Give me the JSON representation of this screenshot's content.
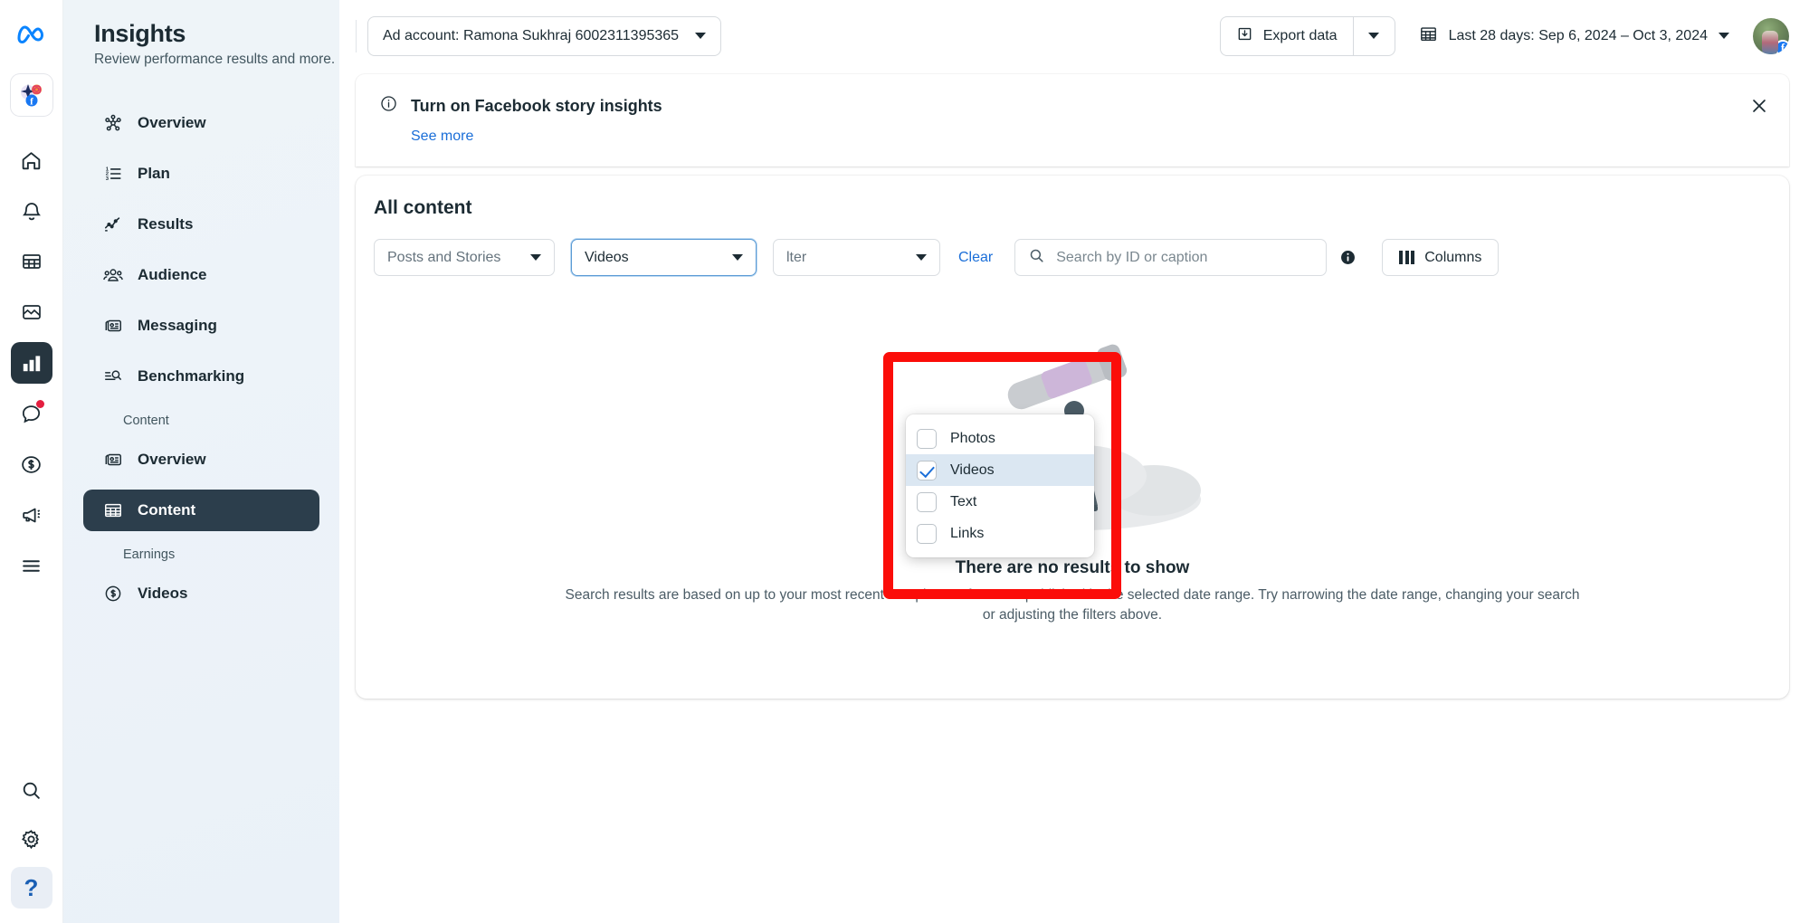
{
  "rail": {
    "icons": [
      {
        "name": "meta-logo-icon",
        "label": "Meta"
      },
      {
        "name": "ai-suite-icon",
        "label": "Meta AI suite"
      },
      {
        "name": "home-icon",
        "label": "Home"
      },
      {
        "name": "notifications-bell-icon",
        "label": "Notifications"
      },
      {
        "name": "table-icon",
        "label": "Table"
      },
      {
        "name": "media-icon",
        "label": "Media"
      },
      {
        "name": "insights-bar-chart-icon",
        "label": "Insights"
      },
      {
        "name": "messages-icon",
        "label": "Messages"
      },
      {
        "name": "monetization-icon",
        "label": "Monetization"
      },
      {
        "name": "ads-megaphone-icon",
        "label": "Ads"
      },
      {
        "name": "more-menu-icon",
        "label": "More"
      },
      {
        "name": "search-icon",
        "label": "Search"
      },
      {
        "name": "settings-gear-icon",
        "label": "Settings"
      },
      {
        "name": "help-icon",
        "label": "Help"
      }
    ],
    "help_glyph": "?"
  },
  "sidebar": {
    "title": "Insights",
    "subtitle": "Review performance results and more.",
    "items": [
      {
        "label": "Overview",
        "icon": "network-overview-icon",
        "active": false
      },
      {
        "label": "Plan",
        "icon": "numbered-list-icon",
        "active": false
      },
      {
        "label": "Results",
        "icon": "line-chart-icon",
        "active": false
      },
      {
        "label": "Audience",
        "icon": "people-icon",
        "active": false
      },
      {
        "label": "Messaging",
        "icon": "cards-icon",
        "active": false
      },
      {
        "label": "Benchmarking",
        "icon": "compare-search-icon",
        "active": false
      }
    ],
    "sections": [
      {
        "heading": "Content",
        "items": [
          {
            "label": "Overview",
            "icon": "cards-icon",
            "active": false
          },
          {
            "label": "Content",
            "icon": "grid-table-icon",
            "active": true
          }
        ]
      },
      {
        "heading": "Earnings",
        "items": [
          {
            "label": "Videos",
            "icon": "dollar-circle-icon",
            "active": false
          }
        ]
      }
    ],
    "collapse_icon": "collapse-panel-icon"
  },
  "topbar": {
    "ad_account": "Ad account: Ramona Sukhraj 6002311395365",
    "export_label": "Export data",
    "export_icon": "download-icon",
    "date_range": "Last 28 days: Sep 6, 2024 – Oct 3, 2024",
    "calendar_icon": "calendar-icon",
    "avatar_badge": "f"
  },
  "banner": {
    "icon": "info-circle-icon",
    "title": "Turn on Facebook story insights",
    "link": "See more",
    "close_icon": "close-icon"
  },
  "content": {
    "title": "All content",
    "filters": {
      "posts_and_stories": "Posts and Stories",
      "media_type": "Videos",
      "third_filter": "lter",
      "clear_label": "Clear",
      "search_placeholder": "Search by ID or caption",
      "search_value": "",
      "search_icon": "search-icon",
      "info_icon": "info-icon",
      "columns_label": "Columns",
      "columns_icon": "columns-icon"
    },
    "dropdown": {
      "options": [
        {
          "label": "Photos",
          "checked": false
        },
        {
          "label": "Videos",
          "checked": true
        },
        {
          "label": "Text",
          "checked": false
        },
        {
          "label": "Links",
          "checked": false
        }
      ]
    },
    "empty_state": {
      "illustration": "telescope-illustration",
      "title": "There are no results to show",
      "description": "Search results are based on up to your most recent 200 pieces of content published in the selected date range. Try narrowing the date range, changing your search or adjusting the filters above."
    }
  },
  "highlight": {
    "color": "#fb0d09",
    "name": "red-highlight-box"
  }
}
